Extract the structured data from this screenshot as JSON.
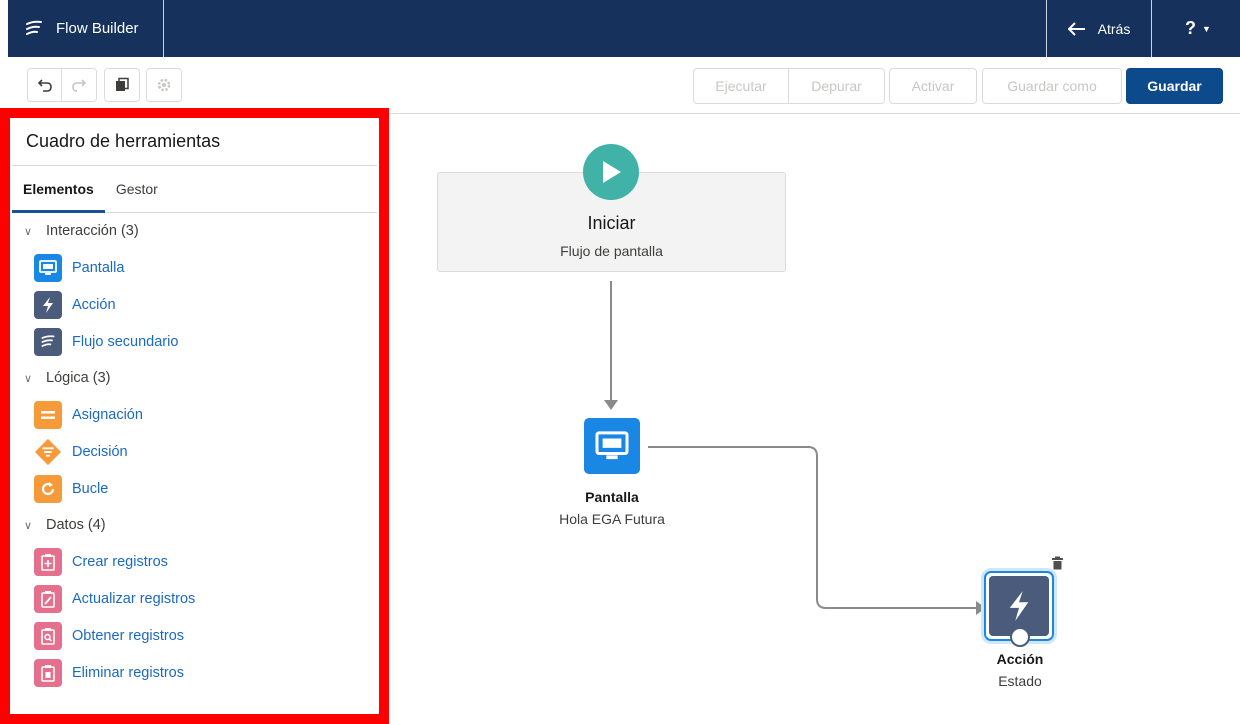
{
  "header": {
    "app_title": "Flow Builder",
    "back_label": "Atrás",
    "help_label": "?"
  },
  "toolbar": {
    "run": "Ejecutar",
    "debug": "Depurar",
    "activate": "Activar",
    "save_as": "Guardar como",
    "save": "Guardar"
  },
  "toolbox": {
    "title": "Cuadro de herramientas",
    "tabs": [
      "Elementos",
      "Gestor"
    ],
    "sections": [
      {
        "label": "Interacción (3)",
        "items": [
          "Pantalla",
          "Acción",
          "Flujo secundario"
        ]
      },
      {
        "label": "Lógica (3)",
        "items": [
          "Asignación",
          "Decisión",
          "Bucle"
        ]
      },
      {
        "label": "Datos (4)",
        "items": [
          "Crear registros",
          "Actualizar registros",
          "Obtener registros",
          "Eliminar registros"
        ]
      }
    ]
  },
  "canvas": {
    "start": {
      "title": "Iniciar",
      "subtitle": "Flujo de pantalla"
    },
    "screen_node": {
      "title": "Pantalla",
      "subtitle": "Hola EGA Futura"
    },
    "action_node": {
      "title": "Acción",
      "subtitle": "Estado"
    }
  },
  "colors": {
    "header_bg": "#16325c",
    "primary_button": "#0c4a8c",
    "highlight_frame": "#ff0000",
    "link": "#1b6ac1"
  }
}
